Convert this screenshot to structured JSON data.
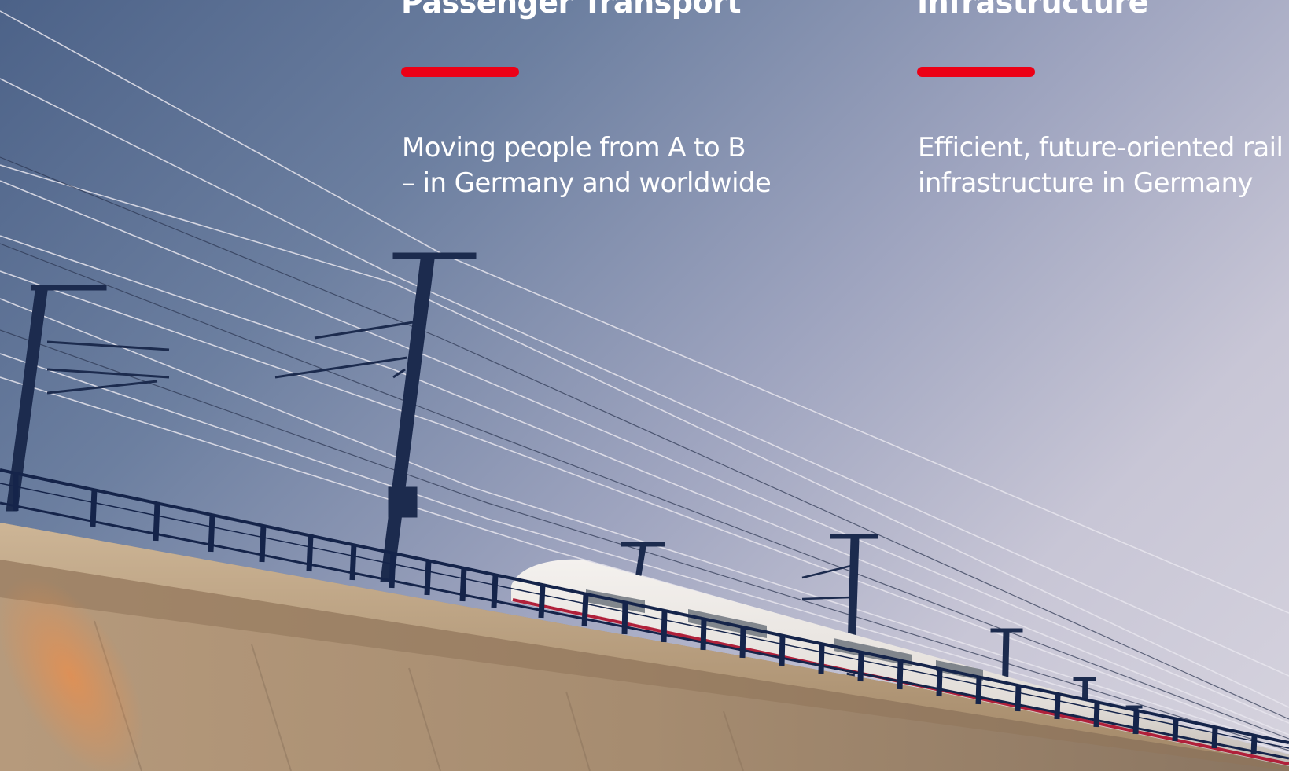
{
  "columns": [
    {
      "title": "Passenger Transport",
      "description_lines": [
        "Moving people from A to B",
        "– in Germany and worldwide"
      ]
    },
    {
      "title": "Infrastructure",
      "description_lines": [
        "Efficient, future-oriented rail",
        "infrastructure in Germany"
      ]
    }
  ],
  "colors": {
    "accent": "#ec0016",
    "text": "#ffffff",
    "sky_dark": "#4c6288",
    "sky_light": "#d6d3de"
  },
  "image": {
    "subject": "high-speed-train-on-viaduct-photo"
  }
}
